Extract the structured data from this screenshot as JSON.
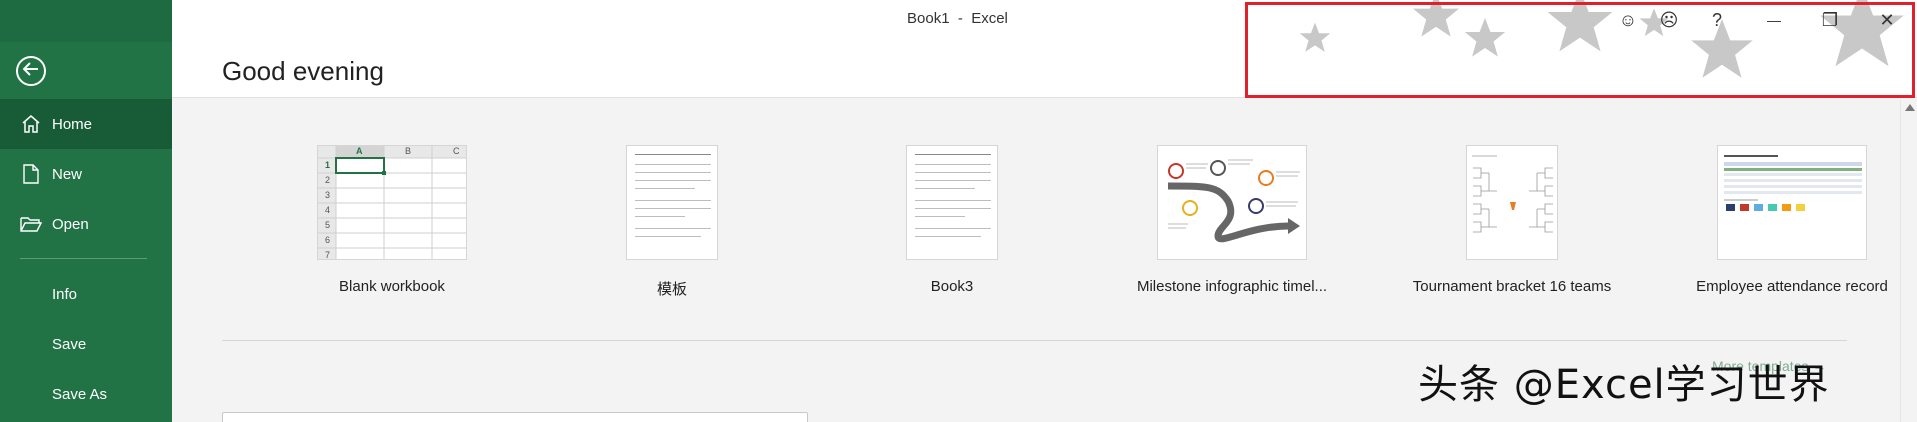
{
  "window": {
    "title": "Book1  -  Excel"
  },
  "sidebar": {
    "back_label": "",
    "items": [
      {
        "label": "Home",
        "icon": "home-icon"
      },
      {
        "label": "New",
        "icon": "new-document-icon"
      },
      {
        "label": "Open",
        "icon": "folder-open-icon"
      },
      {
        "label": "Info"
      },
      {
        "label": "Save"
      },
      {
        "label": "Save As"
      }
    ]
  },
  "header": {
    "greeting": "Good evening"
  },
  "window_controls": [
    {
      "name": "smile-feedback-icon",
      "glyph": "☺"
    },
    {
      "name": "frown-feedback-icon",
      "glyph": "☹"
    },
    {
      "name": "help-icon",
      "glyph": "?"
    },
    {
      "name": "minimize-icon",
      "glyph": "—"
    },
    {
      "name": "restore-icon",
      "glyph": "❐"
    },
    {
      "name": "close-icon",
      "glyph": "✕"
    }
  ],
  "templates": [
    {
      "label": "Blank workbook"
    },
    {
      "label": "模板"
    },
    {
      "label": "Book3"
    },
    {
      "label": "Milestone infographic timel..."
    },
    {
      "label": "Tournament bracket 16 teams"
    },
    {
      "label": "Employee attendance record"
    }
  ],
  "spreadsheet_thumb": {
    "columns": [
      "A",
      "B",
      "C"
    ],
    "rows": [
      "1",
      "2",
      "3",
      "4",
      "5",
      "6",
      "7"
    ]
  },
  "more_templates_label": "More templates →",
  "watermark": "头条 @Excel学习世界",
  "colors": {
    "sidebar": "#217346",
    "accent": "#217346",
    "highlight": "#e0202a"
  }
}
